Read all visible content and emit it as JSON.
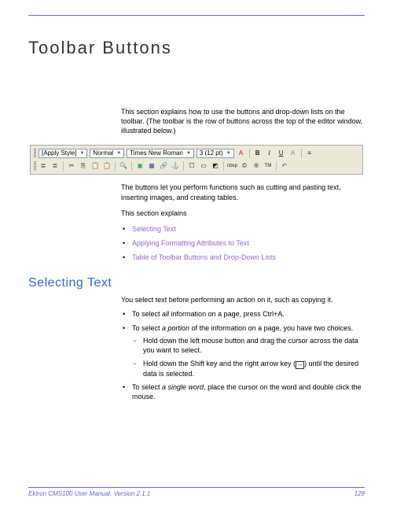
{
  "title": "Toolbar Buttons",
  "intro": "This section explains how to use the buttons and drop-down lists on the toolbar. (The toolbar is the row of buttons across the top of the editor window, illustrated below.)",
  "toolbar": {
    "style_dd": "[Apply Style]",
    "para_dd": "Normal",
    "font_dd": "Times New Roman",
    "size_dd": "3 (12 pt)",
    "nbsp": "nbsp"
  },
  "after1": "The buttons let you perform functions such as cutting and pasting text, inserting images, and creating tables.",
  "after2": "This section explains",
  "links": [
    "Selecting Text",
    "Applying Formatting Attributes to Text",
    "Table of Toolbar Buttons and Drop-Down Lists"
  ],
  "h2": "Selecting Text",
  "sel_intro": "You select text before performing an action on it, such as copying it.",
  "b1a": "To select ",
  "b1b": "all",
  "b1c": " information on a page, press Ctrl+A.",
  "b2a": "To select ",
  "b2b": "a portion",
  "b2c": " of the information on a page, you have two choices.",
  "s1": "Hold down the left mouse button and drag the cursor across the data you want to select.",
  "s2a": "Hold down the Shift key and the right arrow key (",
  "s2b": ") until the desired data is selected.",
  "b3a": "To select ",
  "b3b": "a single word",
  "b3c": ", place the cursor on the word and double click the mouse.",
  "footer_left": "Ektron CMS100 User Manual, Version 2.1.1",
  "footer_right": "129"
}
